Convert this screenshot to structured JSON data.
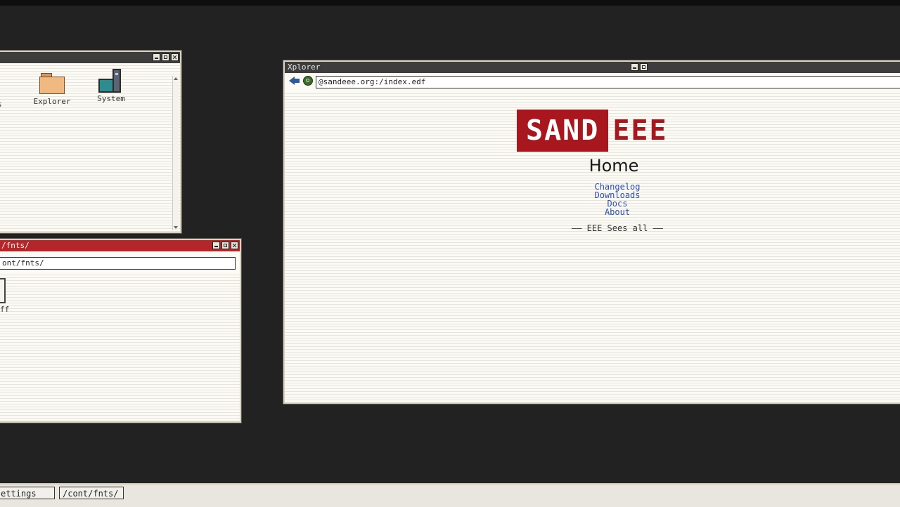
{
  "desktop_window": {
    "icons": [
      {
        "label": "ds",
        "icon": "downloads-icon"
      },
      {
        "label": "Explorer",
        "icon": "folder-icon"
      },
      {
        "label": "System",
        "icon": "computer-icon"
      }
    ]
  },
  "fonts_window": {
    "title": "/fnts/",
    "address": "ont/fnts/",
    "file_label": "ff"
  },
  "xplorer": {
    "title": "Xplorer",
    "address": "@sandeee.org:/index.edf",
    "logo_primary": "SAND",
    "logo_secondary": "EEE",
    "heading": "Home",
    "links": [
      "Changelog",
      "Downloads",
      "Docs",
      "About"
    ],
    "tagline": "—— EEE Sees all ——"
  },
  "taskbar": {
    "items": [
      "ettings",
      "/cont/fnts/"
    ]
  },
  "colors": {
    "brand_red": "#a8161e",
    "active_title": "#b3262a",
    "link_blue": "#2b4fb5",
    "desktop": "#222222"
  }
}
